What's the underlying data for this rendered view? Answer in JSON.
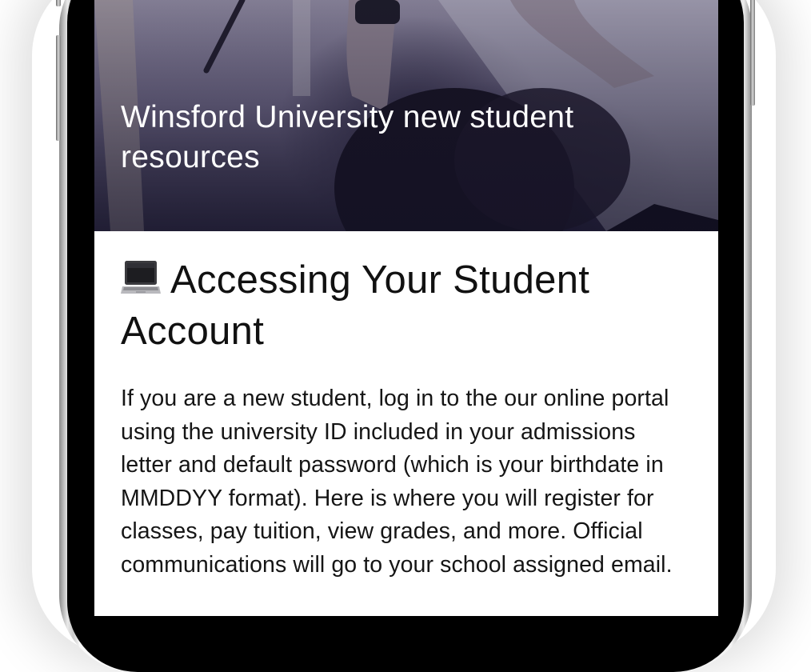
{
  "hero": {
    "title": "Winsford University new student resources"
  },
  "section": {
    "icon": "laptop-icon",
    "heading": "Accessing Your Student Account",
    "body": "If you are a new student, log in to the our online portal using the university ID included in your admissions letter and default password (which is your birthdate in MMDDYY format). Here is where you will register for classes, pay tuition, view grades, and more. Official communications will go to your school assigned email."
  },
  "colors": {
    "hero_overlay": "#2f2b42",
    "text": "#111111",
    "background": "#ffffff"
  }
}
